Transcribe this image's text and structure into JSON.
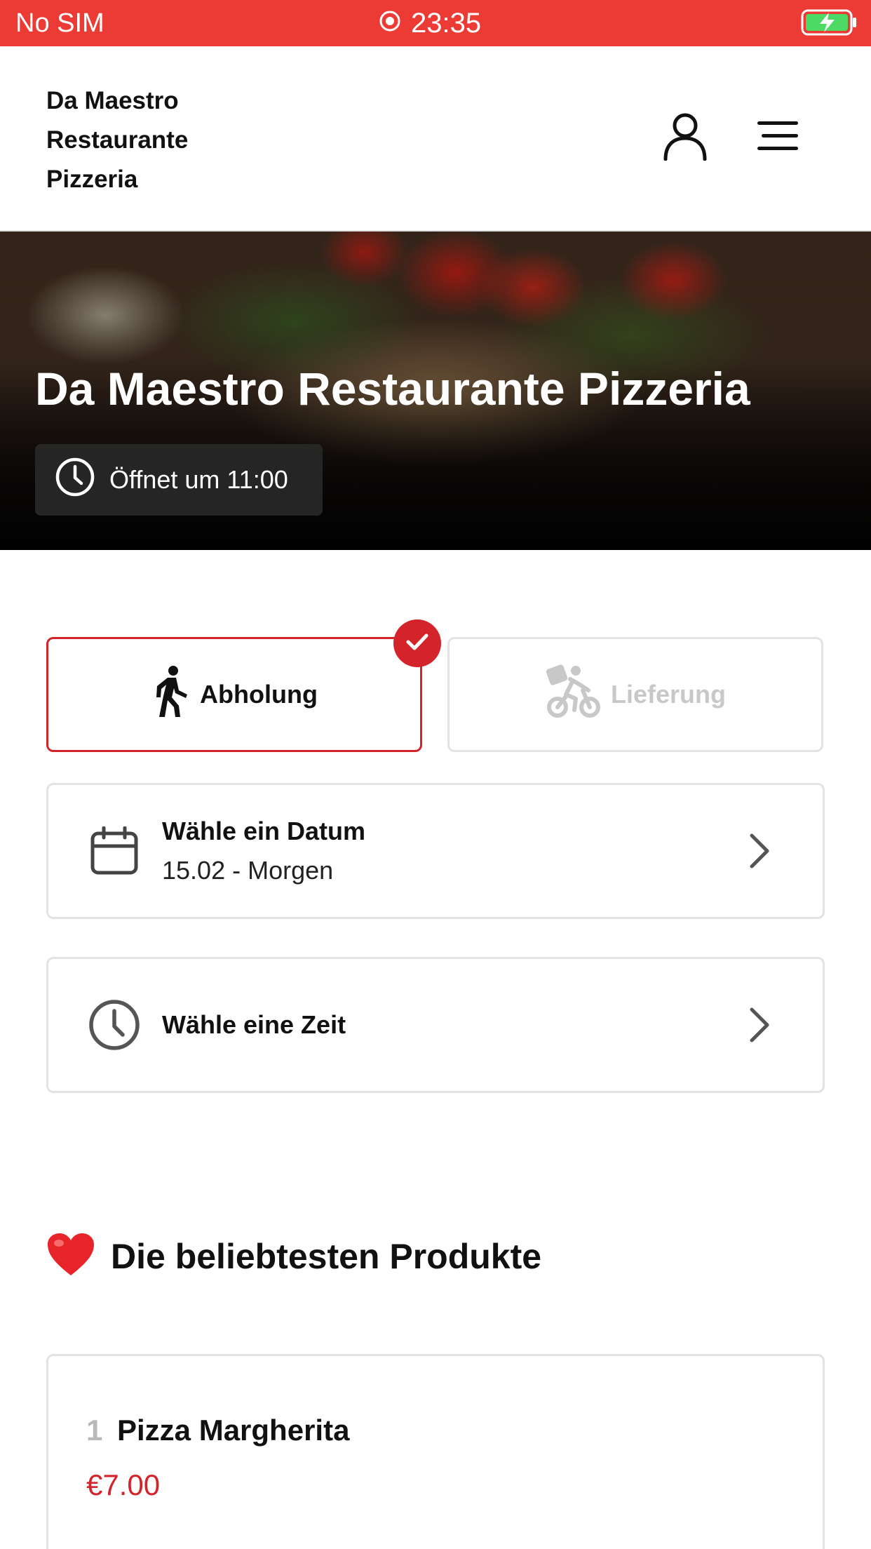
{
  "status_bar": {
    "carrier": "No SIM",
    "time": "23:35"
  },
  "header": {
    "brand_line1": "Da Maestro",
    "brand_line2": "Restaurante",
    "brand_line3": "Pizzeria"
  },
  "hero": {
    "title": "Da Maestro Restaurante Pizzeria",
    "opening_hours": "Öffnet um 11:00"
  },
  "order_mode": {
    "pickup_label": "Abholung",
    "delivery_label": "Lieferung",
    "selected": "pickup"
  },
  "date_selector": {
    "title": "Wähle ein Datum",
    "value": "15.02 - Morgen"
  },
  "time_selector": {
    "title": "Wähle eine Zeit"
  },
  "popular": {
    "heading": "Die beliebtesten Produkte",
    "products": [
      {
        "rank": "1",
        "name": "Pizza Margherita",
        "price": "€7.00"
      }
    ]
  },
  "colors": {
    "accent": "#d4242b",
    "status_bar": "#ec3a35",
    "battery": "#4cd964"
  },
  "icons": [
    "record-icon",
    "battery-charging-icon",
    "user-icon",
    "menu-icon",
    "clock-icon",
    "walking-icon",
    "bike-delivery-icon",
    "check-icon",
    "calendar-icon",
    "chevron-right-icon",
    "heart-icon"
  ]
}
